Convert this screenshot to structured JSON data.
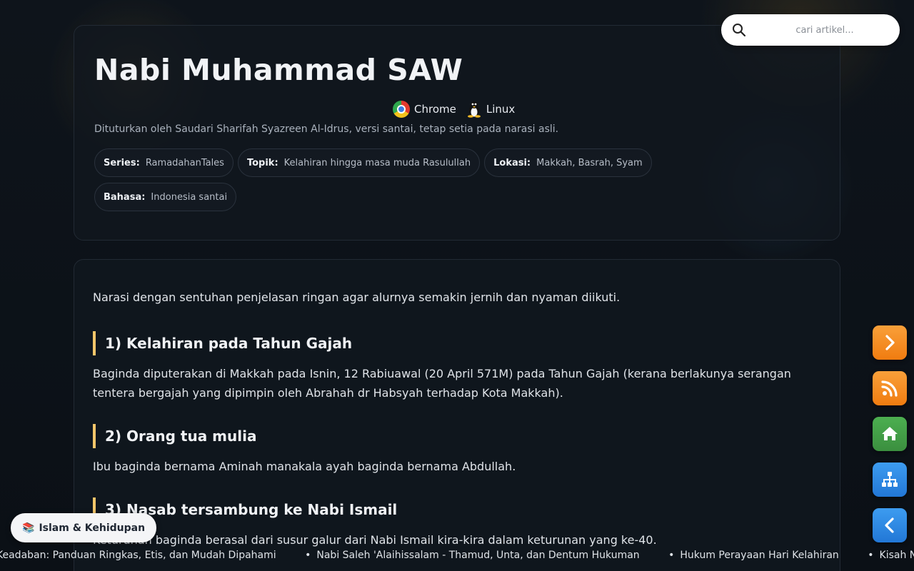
{
  "header": {
    "title": "Nabi Muhammad SAW",
    "env": [
      {
        "icon": "chrome-icon",
        "label": "Chrome"
      },
      {
        "icon": "linux-icon",
        "label": "Linux"
      }
    ],
    "byline": "Dituturkan oleh Saudari Sharifah Syazreen Al-Idrus, versi santai, tetap setia pada narasi asli.",
    "meta": [
      {
        "key": "Series:",
        "value": "RamadahanTales"
      },
      {
        "key": "Topik:",
        "value": "Kelahiran hingga masa muda Rasulullah"
      },
      {
        "key": "Lokasi:",
        "value": "Makkah, Basrah, Syam"
      },
      {
        "key": "Bahasa:",
        "value": "Indonesia santai"
      }
    ]
  },
  "search": {
    "placeholder": "cari artikel...",
    "value": ""
  },
  "article": {
    "intro": "Narasi dengan sentuhan penjelasan ringan agar alurnya semakin jernih dan nyaman diikuti.",
    "sections": [
      {
        "heading": "1) Kelahiran pada Tahun Gajah",
        "body": "Baginda diputerakan di Makkah pada Isnin, 12 Rabiuawal (20 April 571M) pada Tahun Gajah (kerana berlakunya serangan tentera bergajah yang dipimpin oleh Abrahah dr Habsyah terhadap Kota Makkah)."
      },
      {
        "heading": "2) Orang tua mulia",
        "body": "Ibu baginda bernama Aminah manakala ayah baginda bernama Abdullah."
      },
      {
        "heading": "3) Nasab tersambung ke Nabi Ismail",
        "body": "Keturunan baginda berasal dari susur galur dari Nabi Ismail kira-kira dalam keturunan yang ke-40."
      }
    ]
  },
  "fabs": [
    {
      "icon": "chevron-right-icon",
      "color": "#f7901e"
    },
    {
      "icon": "rss-icon",
      "color": "#f7901e"
    },
    {
      "icon": "home-icon",
      "color": "#43a047"
    },
    {
      "icon": "sitemap-icon",
      "color": "#2f8fe6"
    },
    {
      "icon": "chevron-left-icon",
      "color": "#2f8fe6"
    }
  ],
  "category": {
    "icon": "book-icon",
    "label": "Islam & Kehidupan"
  },
  "ticker": [
    "Keadaban: Panduan Ringkas, Etis, dan Mudah Dipahami",
    "Nabi Saleh 'Alaihissalam - Thamud, Unta, dan Dentum Hukuman",
    "Hukum Perayaan Hari Kelahiran",
    "Kisah Nabi"
  ]
}
